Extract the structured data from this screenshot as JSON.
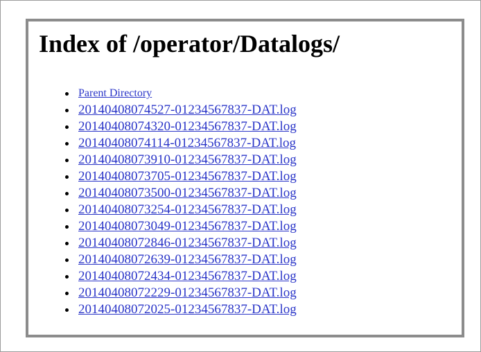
{
  "page": {
    "title": "Index of /operator/Datalogs/"
  },
  "listing": {
    "parent_label": "Parent Directory",
    "files": [
      "20140408074527-01234567837-DAT.log",
      "20140408074320-01234567837-DAT.log",
      "20140408074114-01234567837-DAT.log",
      "20140408073910-01234567837-DAT.log",
      "20140408073705-01234567837-DAT.log",
      "20140408073500-01234567837-DAT.log",
      "20140408073254-01234567837-DAT.log",
      "20140408073049-01234567837-DAT.log",
      "20140408072846-01234567837-DAT.log",
      "20140408072639-01234567837-DAT.log",
      "20140408072434-01234567837-DAT.log",
      "20140408072229-01234567837-DAT.log",
      "20140408072025-01234567837-DAT.log"
    ]
  },
  "colors": {
    "link": "#2a35c8",
    "panel_border": "#8c8c8c"
  }
}
